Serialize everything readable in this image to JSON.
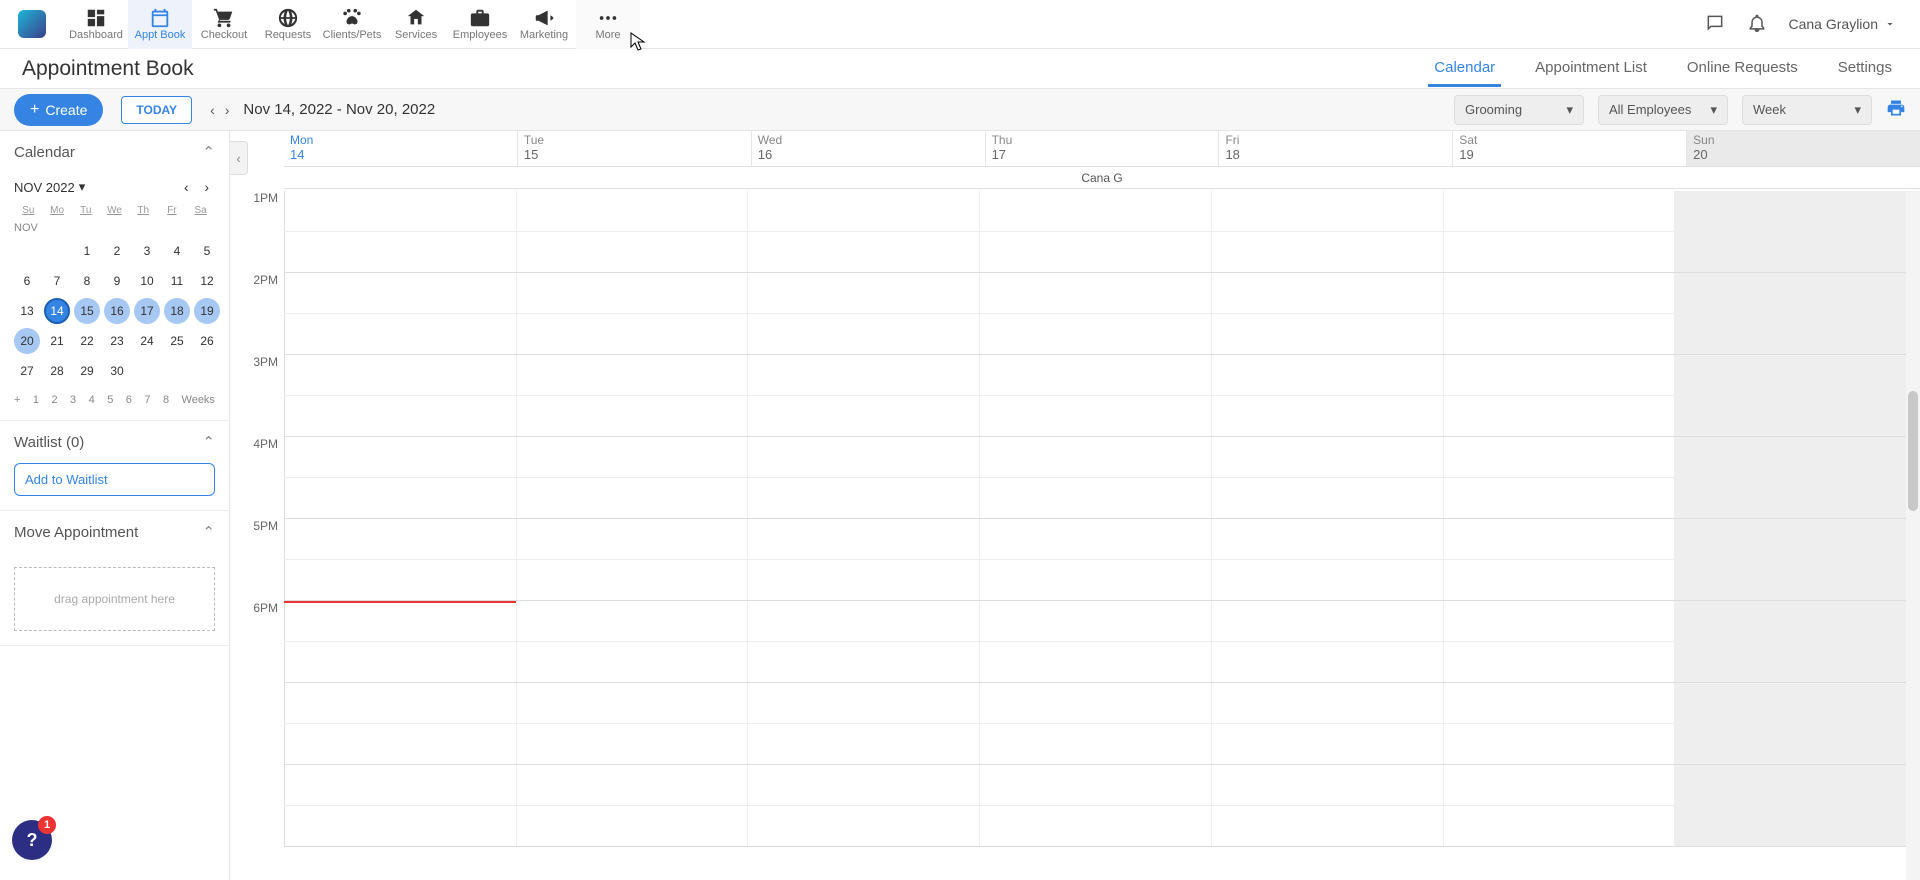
{
  "nav": {
    "items": [
      {
        "label": "Dashboard"
      },
      {
        "label": "Appt Book"
      },
      {
        "label": "Checkout"
      },
      {
        "label": "Requests"
      },
      {
        "label": "Clients/Pets"
      },
      {
        "label": "Services"
      },
      {
        "label": "Employees"
      },
      {
        "label": "Marketing"
      },
      {
        "label": "More"
      }
    ],
    "user_name": "Cana Graylion"
  },
  "subheader": {
    "title": "Appointment Book",
    "tabs": [
      "Calendar",
      "Appointment List",
      "Online Requests",
      "Settings"
    ]
  },
  "toolbar": {
    "create": "Create",
    "today": "TODAY",
    "date_range": "Nov 14, 2022 - Nov 20, 2022",
    "select_service": "Grooming",
    "select_employee": "All Employees",
    "select_view": "Week"
  },
  "sidebar": {
    "calendar_panel": "Calendar",
    "mini_month": "NOV 2022",
    "mini_month_label": "NOV",
    "dow": [
      "Su",
      "Mo",
      "Tu",
      "We",
      "Th",
      "Fr",
      "Sa"
    ],
    "weeks_label": "Weeks",
    "waitlist_title": "Waitlist (0)",
    "add_waitlist": "Add to Waitlist",
    "move_title": "Move Appointment",
    "drop_hint": "drag appointment here"
  },
  "calendar": {
    "days": [
      {
        "name": "Mon",
        "num": "14",
        "active": true
      },
      {
        "name": "Tue",
        "num": "15"
      },
      {
        "name": "Wed",
        "num": "16"
      },
      {
        "name": "Thu",
        "num": "17"
      },
      {
        "name": "Fri",
        "num": "18"
      },
      {
        "name": "Sat",
        "num": "19"
      },
      {
        "name": "Sun",
        "num": "20",
        "sun": true
      }
    ],
    "resource": "Cana G",
    "times": [
      "1PM",
      "2PM",
      "3PM",
      "4PM",
      "5PM",
      "6PM"
    ]
  },
  "help_badge": "1"
}
